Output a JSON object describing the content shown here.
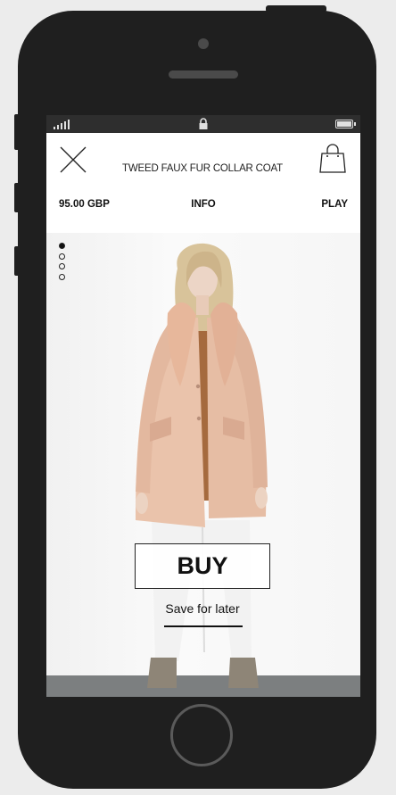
{
  "product": {
    "title": "TWEED FAUX FUR COLLAR COAT",
    "price": "95.00 GBP"
  },
  "nav": {
    "info_label": "INFO",
    "play_label": "PLAY"
  },
  "gallery": {
    "image_count": 4,
    "active_index": 0
  },
  "actions": {
    "buy_label": "BUY",
    "save_label": "Save for later"
  },
  "icons": {
    "close": "close-icon",
    "bag": "shopping-bag-icon",
    "signal": "signal-icon",
    "lock": "lock-icon",
    "battery": "battery-icon"
  },
  "colors": {
    "frame": "#1f1f1f",
    "status_bar": "#2e2e2e",
    "coat": "#eac3ab",
    "text": "#111111"
  }
}
